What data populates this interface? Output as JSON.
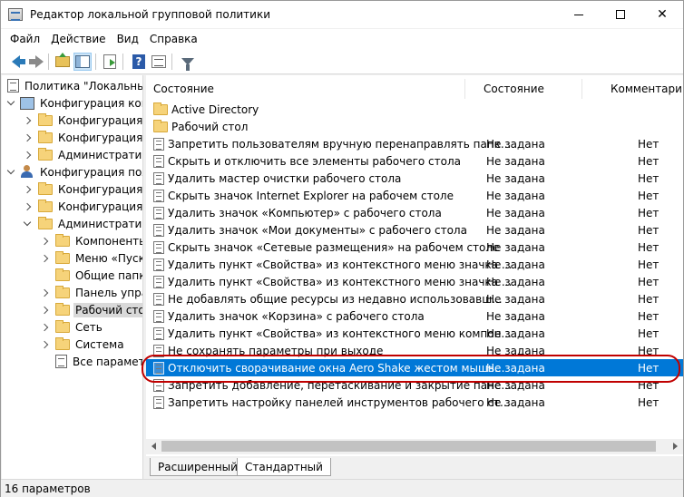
{
  "window": {
    "title": "Редактор локальной групповой политики",
    "min_glyph": "—",
    "max_glyph": "☐",
    "close_glyph": "✕"
  },
  "menu": [
    "Файл",
    "Действие",
    "Вид",
    "Справка"
  ],
  "toolbar": {
    "icons": [
      "back-arrow-icon",
      "forward-arrow-icon",
      "folder-up-icon",
      "show-hide-tree-icon",
      "export-list-icon",
      "help-icon",
      "properties-icon",
      "filter-icon"
    ]
  },
  "tree": [
    {
      "label": "Политика \"Локальный",
      "level": 0,
      "icon": "document-icon",
      "toggle": "none"
    },
    {
      "label": "Конфигурация комп",
      "level": 1,
      "icon": "computer-icon",
      "toggle": "down"
    },
    {
      "label": "Конфигурация п",
      "level": 2,
      "icon": "folder-icon",
      "toggle": "right"
    },
    {
      "label": "Конфигурация W",
      "level": 2,
      "icon": "folder-icon",
      "toggle": "right"
    },
    {
      "label": "Административ",
      "level": 2,
      "icon": "folder-icon",
      "toggle": "right"
    },
    {
      "label": "Конфигурация поль",
      "level": 1,
      "icon": "user-icon",
      "toggle": "down"
    },
    {
      "label": "Конфигурация п",
      "level": 2,
      "icon": "folder-icon",
      "toggle": "right"
    },
    {
      "label": "Конфигурация W",
      "level": 2,
      "icon": "folder-icon",
      "toggle": "right"
    },
    {
      "label": "Административ",
      "level": 2,
      "icon": "folder-icon",
      "toggle": "down"
    },
    {
      "label": "Компоненты",
      "level": 3,
      "icon": "folder-icon",
      "toggle": "right"
    },
    {
      "label": "Меню «Пуск",
      "level": 3,
      "icon": "folder-icon",
      "toggle": "right"
    },
    {
      "label": "Общие папк",
      "level": 3,
      "icon": "folder-icon",
      "toggle": "none"
    },
    {
      "label": "Панель упра",
      "level": 3,
      "icon": "folder-icon",
      "toggle": "right"
    },
    {
      "label": "Рабочий сто",
      "level": 3,
      "icon": "folder-icon",
      "toggle": "right",
      "selected": true
    },
    {
      "label": "Сеть",
      "level": 3,
      "icon": "folder-icon",
      "toggle": "right"
    },
    {
      "label": "Система",
      "level": 3,
      "icon": "folder-icon",
      "toggle": "right"
    },
    {
      "label": "Все параметр",
      "level": 3,
      "icon": "document-icon",
      "toggle": "none"
    }
  ],
  "columns": {
    "name": "Состояние",
    "state": "Состояние",
    "comment": "Комментарий"
  },
  "rows": [
    {
      "name": "Active Directory",
      "state": "",
      "comment": "",
      "icon": "folder-icon"
    },
    {
      "name": "Рабочий стол",
      "state": "",
      "comment": "",
      "icon": "folder-icon"
    },
    {
      "name": "Запретить пользователям вручную перенаправлять папк...",
      "state": "Не задана",
      "comment": "Нет",
      "icon": "setting-icon"
    },
    {
      "name": "Скрыть и отключить все элементы рабочего стола",
      "state": "Не задана",
      "comment": "Нет",
      "icon": "setting-icon"
    },
    {
      "name": "Удалить мастер очистки рабочего стола",
      "state": "Не задана",
      "comment": "Нет",
      "icon": "setting-icon"
    },
    {
      "name": "Скрыть значок Internet Explorer на рабочем столе",
      "state": "Не задана",
      "comment": "Нет",
      "icon": "setting-icon"
    },
    {
      "name": "Удалить значок «Компьютер» с рабочего стола",
      "state": "Не задана",
      "comment": "Нет",
      "icon": "setting-icon"
    },
    {
      "name": "Удалить значок «Мои документы» с рабочего стола",
      "state": "Не задана",
      "comment": "Нет",
      "icon": "setting-icon"
    },
    {
      "name": "Скрыть значок «Сетевые размещения» на рабочем столе",
      "state": "Не задана",
      "comment": "Нет",
      "icon": "setting-icon"
    },
    {
      "name": "Удалить пункт «Свойства» из контекстного меню значка ...",
      "state": "Не задана",
      "comment": "Нет",
      "icon": "setting-icon"
    },
    {
      "name": "Удалить пункт «Свойства» из контекстного меню значка ...",
      "state": "Не задана",
      "comment": "Нет",
      "icon": "setting-icon"
    },
    {
      "name": "Не добавлять общие ресурсы из недавно использовавш...",
      "state": "Не задана",
      "comment": "Нет",
      "icon": "setting-icon"
    },
    {
      "name": "Удалить значок «Корзина» с рабочего стола",
      "state": "Не задана",
      "comment": "Нет",
      "icon": "setting-icon"
    },
    {
      "name": "Удалить пункт «Свойства» из контекстного меню компон...",
      "state": "Не задана",
      "comment": "Нет",
      "icon": "setting-icon"
    },
    {
      "name": "Не сохранять параметры при выходе",
      "state": "Не задана",
      "comment": "Нет",
      "icon": "setting-icon"
    },
    {
      "name": "Отключить сворачивание окна Aero Shake жестом мышь...",
      "state": "Не задана",
      "comment": "Нет",
      "icon": "setting-icon",
      "highlighted": true
    },
    {
      "name": "Запретить добавление, перетаскивание и закрытие пане...",
      "state": "Не задана",
      "comment": "Нет",
      "icon": "setting-icon"
    },
    {
      "name": "Запретить настройку панелей инструментов рабочего ст...",
      "state": "Не задана",
      "comment": "Нет",
      "icon": "setting-icon"
    }
  ],
  "tabs": [
    "Расширенный",
    "Стандартный"
  ],
  "status": "16 параметров",
  "colors": {
    "selection": "#0078d7",
    "annotation_ring": "#c00000"
  }
}
